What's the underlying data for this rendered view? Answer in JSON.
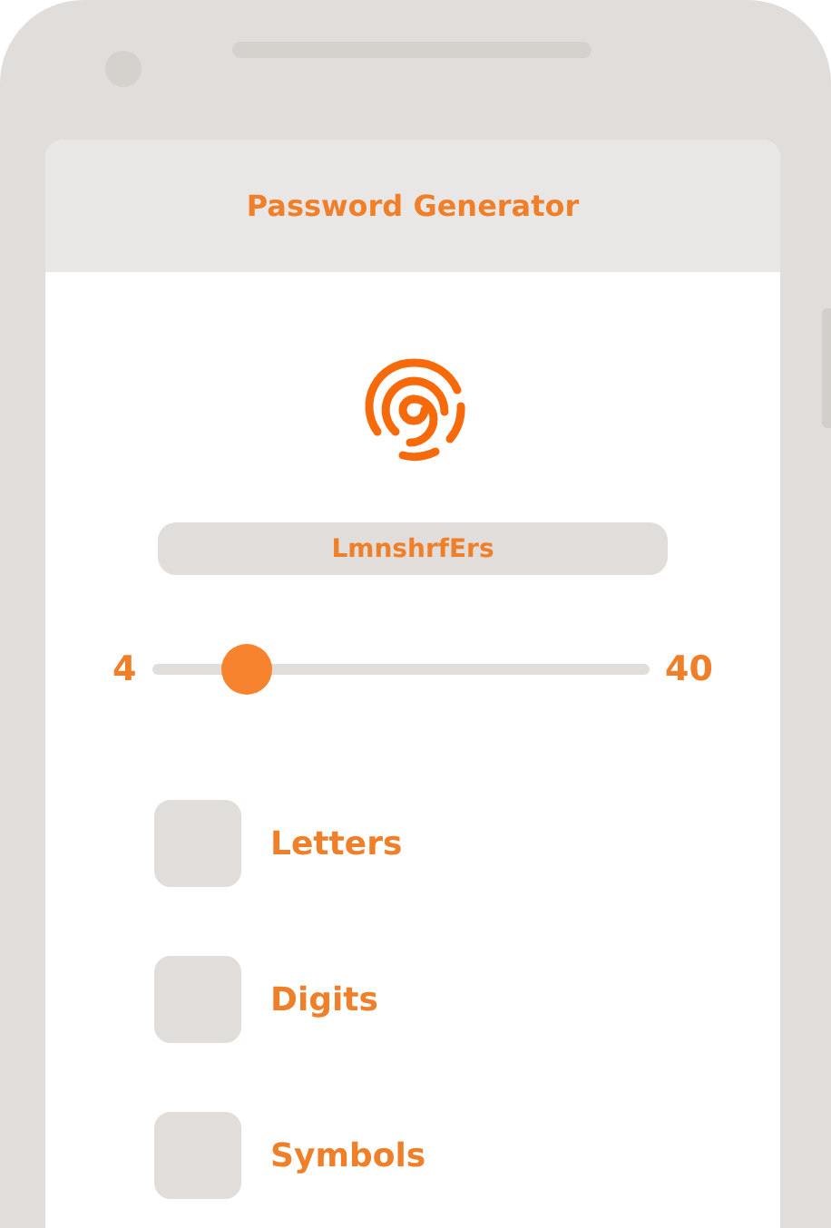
{
  "header": {
    "title": "Password Generator"
  },
  "password": {
    "value": "LmnshrfErs"
  },
  "length_slider": {
    "min_label": "4",
    "max_label": "40",
    "level": 0.19
  },
  "options": [
    {
      "label": "Letters",
      "checked": false
    },
    {
      "label": "Digits",
      "checked": false
    },
    {
      "label": "Symbols",
      "checked": false
    }
  ]
}
